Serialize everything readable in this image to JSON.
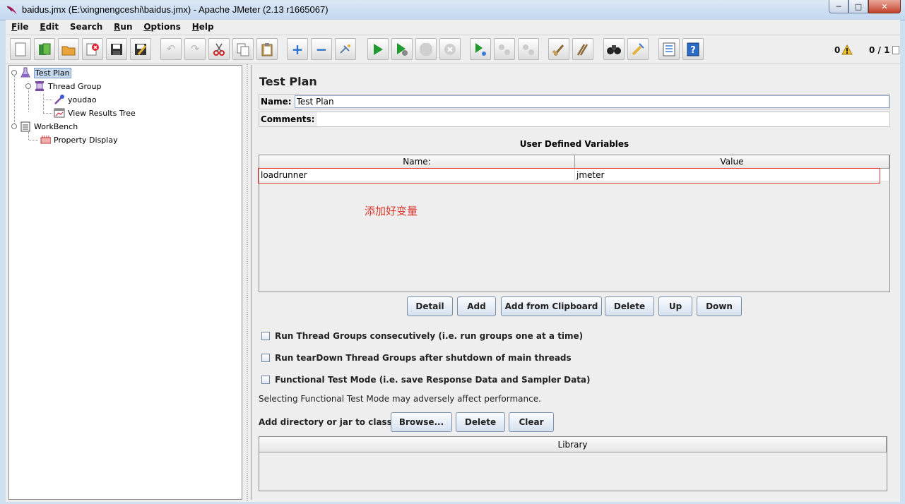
{
  "window": {
    "title": "baidus.jmx (E:\\xingnengceshi\\baidus.jmx) - Apache JMeter (2.13 r1665067)",
    "controls": [
      "minimize-icon",
      "maximize-icon",
      "close-icon"
    ]
  },
  "menubar": [
    {
      "mn": "F",
      "rest": "ile"
    },
    {
      "mn": "E",
      "rest": "dit"
    },
    {
      "mn": "",
      "rest": "Search"
    },
    {
      "mn": "R",
      "rest": "un"
    },
    {
      "mn": "O",
      "rest": "ptions"
    },
    {
      "mn": "H",
      "rest": "elp"
    }
  ],
  "toolbar": {
    "icons": [
      "new-icon",
      "templates-icon",
      "open-icon",
      "close-test-icon",
      "save-icon",
      "save-as-icon",
      "undo-icon",
      "redo-icon",
      "cut-icon",
      "copy-icon",
      "paste-icon",
      "expand-icon",
      "collapse-icon",
      "toggle-icon",
      "start-icon",
      "start-no-pause-icon",
      "stop-icon",
      "shutdown-icon",
      "remote-start-icon",
      "remote-stop-icon",
      "remote-shutdown-icon",
      "clear-icon",
      "clear-all-icon",
      "search-icon",
      "reset-search-icon",
      "function-helper-icon",
      "help-icon"
    ],
    "warning_count": "0",
    "threads": "0 / 1"
  },
  "tree": {
    "test_plan": "Test Plan",
    "thread_group": "Thread Group",
    "sampler": "youdao",
    "listener": "View Results Tree",
    "workbench": "WorkBench",
    "property_display": "Property Display"
  },
  "panel": {
    "title": "Test Plan",
    "name_label": "Name:",
    "name_value": "Test Plan",
    "comments_label": "Comments:",
    "comments_value": "",
    "udv_title": "User Defined Variables",
    "columns": [
      "Name:",
      "Value"
    ],
    "rows": [
      {
        "name": "loadrunner",
        "value": "jmeter"
      }
    ],
    "annotation": "添加好变量",
    "buttons": [
      "Detail",
      "Add",
      "Add from Clipboard",
      "Delete",
      "Up",
      "Down"
    ],
    "checkboxes": [
      {
        "label": "Run Thread Groups consecutively (i.e. run groups one at a time)",
        "checked": false
      },
      {
        "label": "Run tearDown Thread Groups after shutdown of main threads",
        "checked": false
      },
      {
        "label": "Functional Test Mode (i.e. save Response Data and Sampler Data)",
        "checked": false
      }
    ],
    "functional_note": "Selecting Functional Test Mode may adversely affect performance.",
    "classpath_label": "Add directory or jar to classpath",
    "classpath_buttons": [
      "Browse...",
      "Delete",
      "Clear"
    ],
    "library_header": "Library"
  }
}
